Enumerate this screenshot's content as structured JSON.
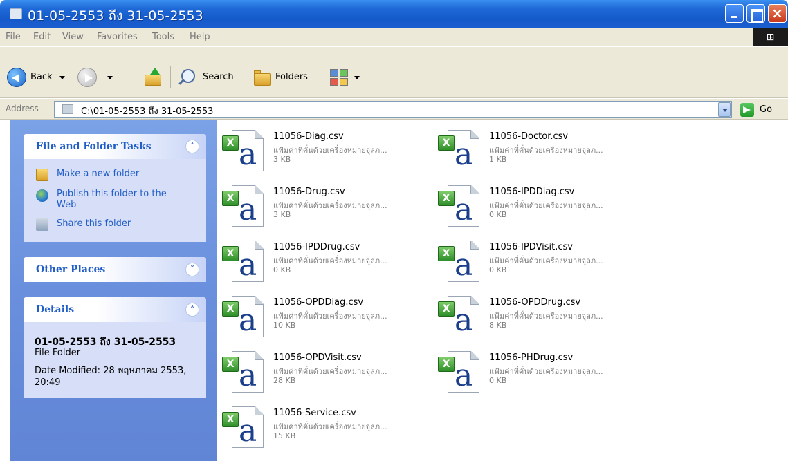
{
  "window": {
    "title": "01-05-2553 ถึง 31-05-2553",
    "minimize_glyph": "",
    "maximize_glyph": "",
    "close_glyph": "×"
  },
  "menu": {
    "items": [
      "File",
      "Edit",
      "View",
      "Favorites",
      "Tools",
      "Help"
    ]
  },
  "toolbar": {
    "back_label": "Back",
    "search_label": "Search",
    "folders_label": "Folders"
  },
  "address": {
    "label": "Address",
    "value": "C:\\01-05-2553 ถึง 31-05-2553",
    "go_label": "Go"
  },
  "left_panel": {
    "file_tasks": {
      "title": "File and Folder Tasks",
      "items": [
        "Make a new folder",
        "Publish this folder to the Web",
        "Share this folder"
      ]
    },
    "other_places": {
      "title": "Other Places"
    },
    "details": {
      "title": "Details",
      "name": "01-05-2553 ถึง 31-05-2553",
      "type": "File Folder",
      "date_modified": "Date Modified: 28 พฤษภาคม 2553, 20:49"
    }
  },
  "files": [
    {
      "name": "11056-Diag.csv",
      "type": "แฟ้มค่าที่คั่นด้วยเครื่องหมายจุลภ...",
      "size": "3 KB"
    },
    {
      "name": "11056-Doctor.csv",
      "type": "แฟ้มค่าที่คั่นด้วยเครื่องหมายจุลภ...",
      "size": "1 KB"
    },
    {
      "name": "11056-Drug.csv",
      "type": "แฟ้มค่าที่คั่นด้วยเครื่องหมายจุลภ...",
      "size": "3 KB"
    },
    {
      "name": "11056-IPDDiag.csv",
      "type": "แฟ้มค่าที่คั่นด้วยเครื่องหมายจุลภ...",
      "size": "0 KB"
    },
    {
      "name": "11056-IPDDrug.csv",
      "type": "แฟ้มค่าที่คั่นด้วยเครื่องหมายจุลภ...",
      "size": "0 KB"
    },
    {
      "name": "11056-IPDVisit.csv",
      "type": "แฟ้มค่าที่คั่นด้วยเครื่องหมายจุลภ...",
      "size": "0 KB"
    },
    {
      "name": "11056-OPDDiag.csv",
      "type": "แฟ้มค่าที่คั่นด้วยเครื่องหมายจุลภ...",
      "size": "10 KB"
    },
    {
      "name": "11056-OPDDrug.csv",
      "type": "แฟ้มค่าที่คั่นด้วยเครื่องหมายจุลภ...",
      "size": "8 KB"
    },
    {
      "name": "11056-OPDVisit.csv",
      "type": "แฟ้มค่าที่คั่นด้วยเครื่องหมายจุลภ...",
      "size": "28 KB"
    },
    {
      "name": "11056-PHDrug.csv",
      "type": "แฟ้มค่าที่คั่นด้วยเครื่องหมายจุลภ...",
      "size": "0 KB"
    },
    {
      "name": "11056-Service.csv",
      "type": "แฟ้มค่าที่คั่นด้วยเครื่องหมายจุลภ...",
      "size": "15 KB"
    }
  ],
  "icons": {
    "file_icon_glyph": "a",
    "excel_badge_glyph": "X",
    "chevron_up": "˄",
    "chevron_down": "˅",
    "windows_logo": "⊞"
  },
  "colors": {
    "titlebar": "#1f6ad8",
    "task_link": "#215dc6",
    "left_pane": "#6a8fdd",
    "file_meta": "#7d7d7d"
  }
}
